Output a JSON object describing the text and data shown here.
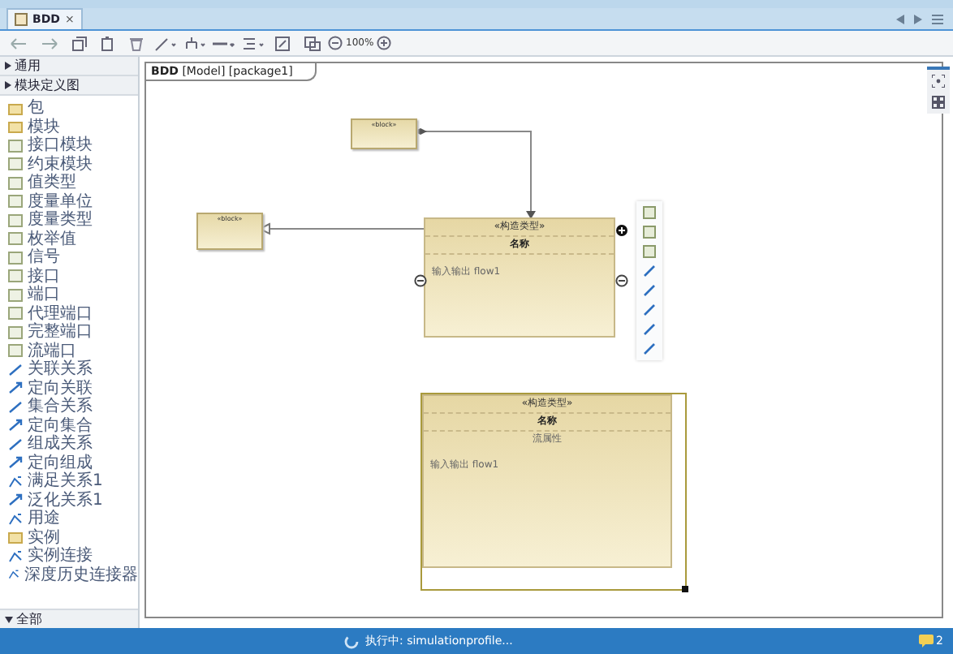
{
  "tab": {
    "label": "BDD",
    "close": "×"
  },
  "toolbar": {
    "zoom": "100%"
  },
  "palette": {
    "sections": [
      {
        "label": "通用"
      },
      {
        "label": "模块定义图"
      }
    ],
    "items": [
      {
        "label": "包",
        "kind": "folder"
      },
      {
        "label": "模块",
        "kind": "folder"
      },
      {
        "label": "接口模块",
        "kind": "box"
      },
      {
        "label": "约束模块",
        "kind": "box"
      },
      {
        "label": "值类型",
        "kind": "box"
      },
      {
        "label": "度量单位",
        "kind": "box"
      },
      {
        "label": "度量类型",
        "kind": "box"
      },
      {
        "label": "枚举值",
        "kind": "box"
      },
      {
        "label": "信号",
        "kind": "box"
      },
      {
        "label": "接口",
        "kind": "box"
      },
      {
        "label": "端口",
        "kind": "box"
      },
      {
        "label": "代理端口",
        "kind": "box"
      },
      {
        "label": "完整端口",
        "kind": "box"
      },
      {
        "label": "流端口",
        "kind": "box"
      },
      {
        "label": "关联关系",
        "kind": "line"
      },
      {
        "label": "定向关联",
        "kind": "arrow"
      },
      {
        "label": "集合关系",
        "kind": "line"
      },
      {
        "label": "定向集合",
        "kind": "arrow"
      },
      {
        "label": "组成关系",
        "kind": "line"
      },
      {
        "label": "定向组成",
        "kind": "arrow"
      },
      {
        "label": "满足关系1",
        "kind": "branch"
      },
      {
        "label": "泛化关系1",
        "kind": "arrow"
      },
      {
        "label": "用途",
        "kind": "branch"
      },
      {
        "label": "实例",
        "kind": "folder"
      },
      {
        "label": "实例连接",
        "kind": "branch"
      },
      {
        "label": "深度历史连接器",
        "kind": "branch"
      }
    ],
    "footer": {
      "label": "全部"
    }
  },
  "diagram": {
    "frame_title": "**BDD** [Model] [package1]",
    "small_blocks": [
      {
        "stereotype": "«block»"
      },
      {
        "stereotype": "«block»"
      }
    ],
    "blocks": [
      {
        "stereotype": "«构造类型»",
        "name": "名称",
        "compartments": [
          "输入输出 flow1"
        ],
        "selected": false
      },
      {
        "stereotype": "«构造类型»",
        "name": "名称",
        "compartment_title": "流属性",
        "compartments": [
          "输入输出 flow1"
        ],
        "selected": true
      }
    ]
  },
  "status_bar": {
    "text": "执行中: simulationprofile...",
    "notifications": "2"
  }
}
